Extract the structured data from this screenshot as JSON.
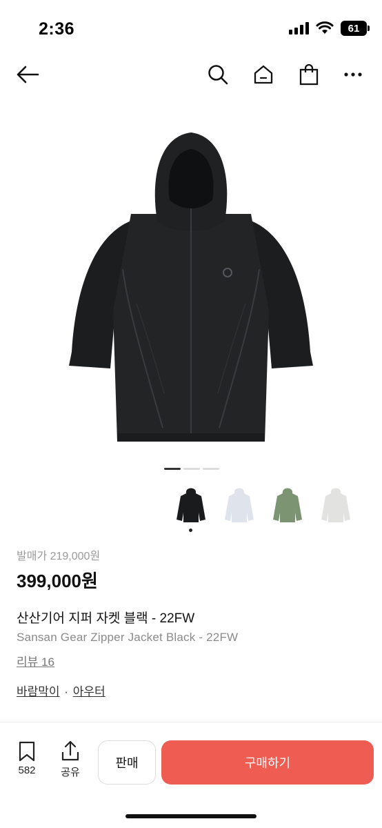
{
  "status": {
    "time": "2:36",
    "battery": "61"
  },
  "nav": {
    "icons": [
      "back-arrow-icon",
      "search-icon",
      "home-icon",
      "shopping-bag-icon",
      "more-icon"
    ]
  },
  "colors": {
    "accent": "#ee5c52",
    "jacket_main": "#1f2022"
  },
  "gallery": {
    "pages": 3,
    "active_page": 1
  },
  "thumbnails": [
    {
      "color": "black",
      "selected": true
    },
    {
      "color": "light-blue-grey",
      "selected": false
    },
    {
      "color": "olive-green",
      "selected": false
    },
    {
      "color": "light-grey",
      "selected": false
    }
  ],
  "product": {
    "original_price": "발매가 219,000원",
    "price": "399,000원",
    "name_ko": "산산기어 지퍼 자켓 블랙 - 22FW",
    "name_en": "Sansan Gear Zipper Jacket Black - 22FW",
    "review": "리뷰 16",
    "category_1": "바람막이",
    "category_sep": "·",
    "category_2": "아우터"
  },
  "bottom": {
    "bookmark_count": "582",
    "share_label": "공유",
    "sell_label": "판매",
    "buy_label": "구매하기"
  }
}
